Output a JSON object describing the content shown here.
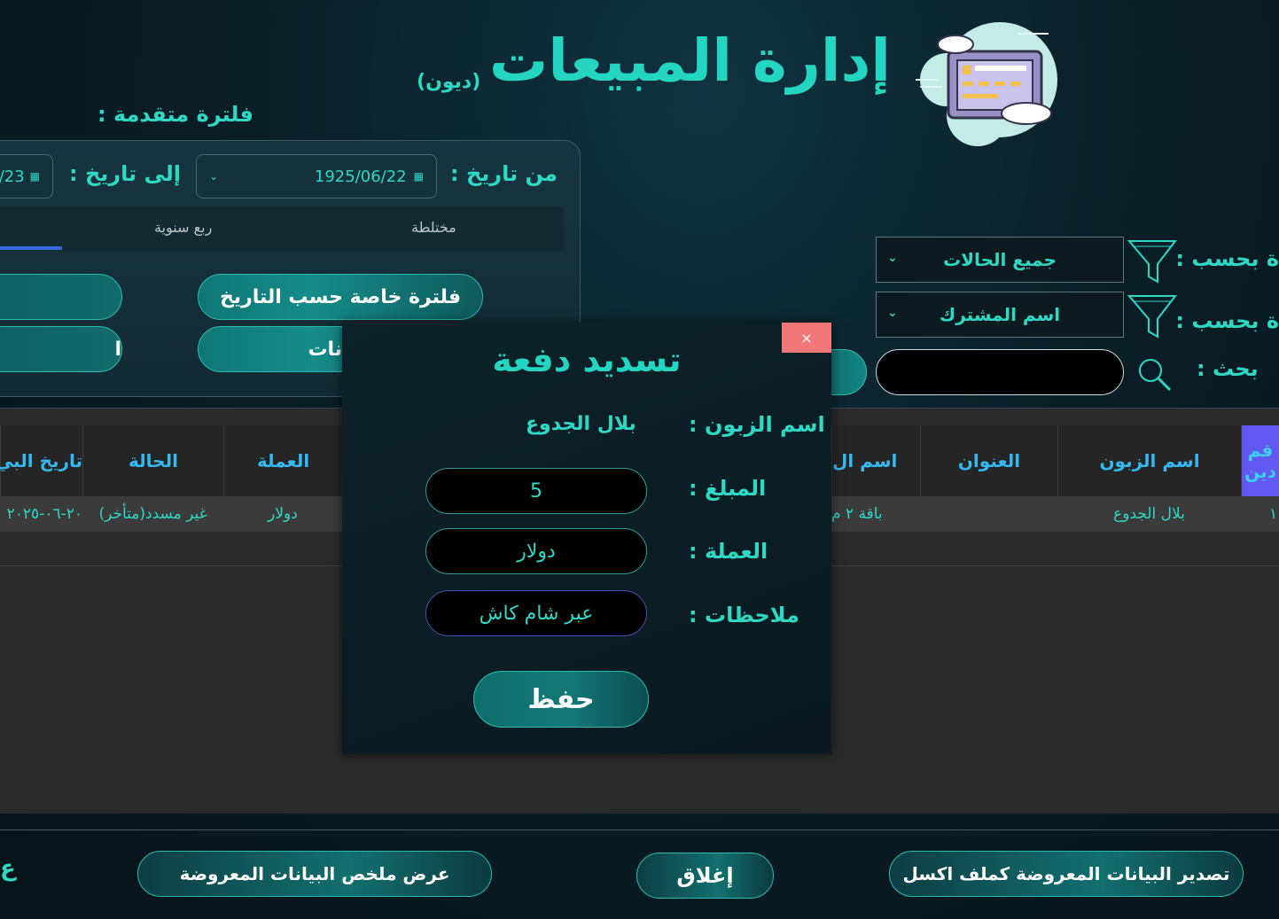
{
  "header": {
    "title": "إدارة المبيعات",
    "subtitle": "(ديون)"
  },
  "filters": {
    "advanced_label": "فلترة متقدمة :",
    "from_date_label": "من تاريخ :",
    "from_date_value": "1925/06/22",
    "to_date_label": "إلى تاريخ :",
    "to_date_value": "/23",
    "tabs": [
      "مختلطة",
      "ربع سنوية"
    ],
    "custom_period_button": "فلترة خاصة حسب التاريخ",
    "data_button": "لبيانات",
    "left_button_1": "",
    "left_button_2": "ا",
    "filter_by_label_1": "ة بحسب :",
    "filter_by_label_2": "ة بحسب :",
    "status_select": "جميع الحالات",
    "field_select": "اسم المشترك",
    "search_label": "بحث :",
    "search_value": ""
  },
  "table": {
    "headers": [
      "قم\nدين",
      "اسم الزبون",
      "العنوان",
      "اسم ال",
      "العملة",
      "الحالة",
      "تاريخ البي"
    ],
    "row": {
      "id": "١",
      "customer": "بلال الجدوع",
      "address": "",
      "package": "باقة ٢ م",
      "currency": "دولار",
      "status": "غير مسدد(متأخر)",
      "date": "٢٠-٠٦-٢٠٢٥"
    }
  },
  "bottom": {
    "export_button": "تصدير البيانات المعروضة كملف اكسل",
    "close_button": "إغلاق",
    "summary_button": "عرض ملخص البيانات المعروضة",
    "edge_char": "ع"
  },
  "modal": {
    "title": "تسديد دفعة",
    "close_icon": "×",
    "customer_label": "اسم الزبون :",
    "customer_value": "بلال الجدوع",
    "amount_label": "المبلغ :",
    "amount_value": "5",
    "currency_label": "العملة :",
    "currency_value": "دولار",
    "notes_label": "ملاحظات :",
    "notes_value": "عبر شام كاش",
    "save_button": "حفظ"
  },
  "colors": {
    "accent": "#24d6c2",
    "header_text": "#35b8f0",
    "active_header": "#6259f2",
    "close_red": "#f27878"
  }
}
